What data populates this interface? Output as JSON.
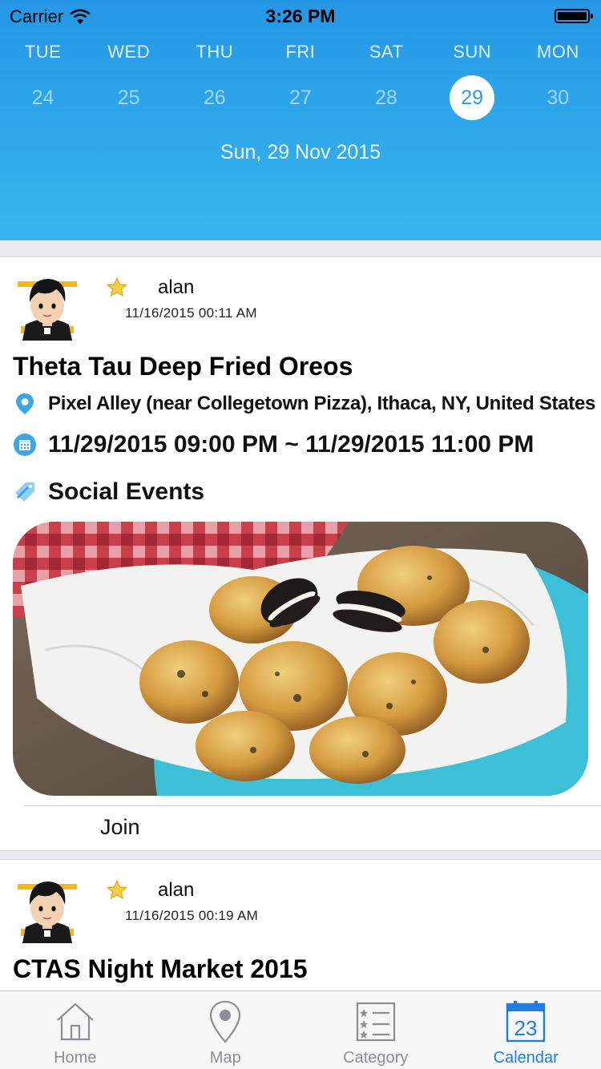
{
  "status_bar": {
    "carrier": "Carrier",
    "time": "3:26 PM"
  },
  "calendar": {
    "days": [
      {
        "name": "TUE",
        "date": "24"
      },
      {
        "name": "WED",
        "date": "25"
      },
      {
        "name": "THU",
        "date": "26"
      },
      {
        "name": "FRI",
        "date": "27"
      },
      {
        "name": "SAT",
        "date": "28"
      },
      {
        "name": "SUN",
        "date": "29",
        "selected": true
      },
      {
        "name": "MON",
        "date": "30"
      }
    ],
    "selected_label": "Sun, 29 Nov 2015"
  },
  "events": [
    {
      "author": "alan",
      "posted": "11/16/2015 00:11 AM",
      "title": "Theta Tau Deep Fried Oreos",
      "location": "Pixel Alley (near Collegetown Pizza), Ithaca, NY, United States",
      "time": "11/29/2015 09:00 PM ~ 11/29/2015 11:00 PM",
      "category": "Social Events",
      "join_label": "Join"
    },
    {
      "author": "alan",
      "posted": "11/16/2015 00:19 AM",
      "title": "CTAS Night Market 2015"
    }
  ],
  "tabs": [
    {
      "label": "Home",
      "icon": "home-icon"
    },
    {
      "label": "Map",
      "icon": "map-pin-icon"
    },
    {
      "label": "Category",
      "icon": "list-icon"
    },
    {
      "label": "Calendar",
      "icon": "calendar-icon",
      "badge": "23",
      "active": true
    }
  ],
  "colors": {
    "header_top": "#2597e6",
    "header_bottom": "#37b6ee",
    "accent": "#1e7fe0",
    "icon_blue": "#3aa6e6"
  }
}
